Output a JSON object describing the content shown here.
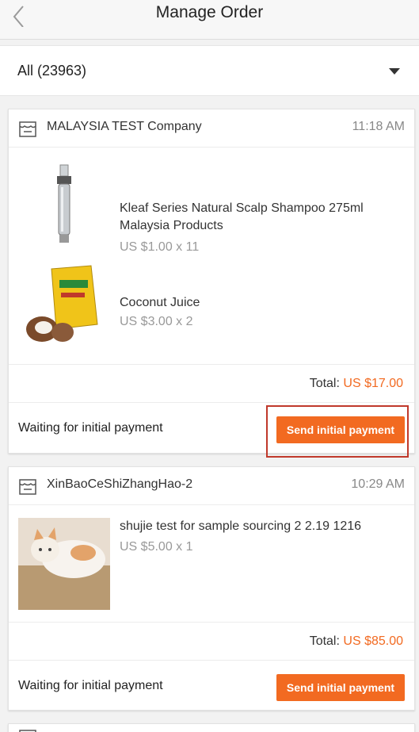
{
  "header": {
    "title": "Manage Order"
  },
  "filter": {
    "selected": "All (23963)"
  },
  "orders": [
    {
      "company": "MALAYSIA TEST Company",
      "time": "11:18 AM",
      "products": [
        {
          "name": "Kleaf Series Natural Scalp Shampoo 275ml Malaysia Products",
          "price": "US $1.00 x 11"
        },
        {
          "name": "Coconut Juice",
          "price": "US $3.00 x 2"
        }
      ],
      "total_label": "Total:",
      "total_amount": "US $17.00",
      "status": "Waiting for initial payment",
      "button_label": "Send initial payment"
    },
    {
      "company": "XinBaoCeShiZhangHao-2",
      "time": "10:29 AM",
      "products": [
        {
          "name": "shujie test for sample sourcing 2 2.19 1216",
          "price": "US $5.00 x 1"
        }
      ],
      "total_label": "Total:",
      "total_amount": "US $85.00",
      "status": "Waiting for initial payment",
      "button_label": "Send initial payment"
    }
  ],
  "colors": {
    "accent": "#f26a21",
    "highlight": "#c0392b"
  }
}
